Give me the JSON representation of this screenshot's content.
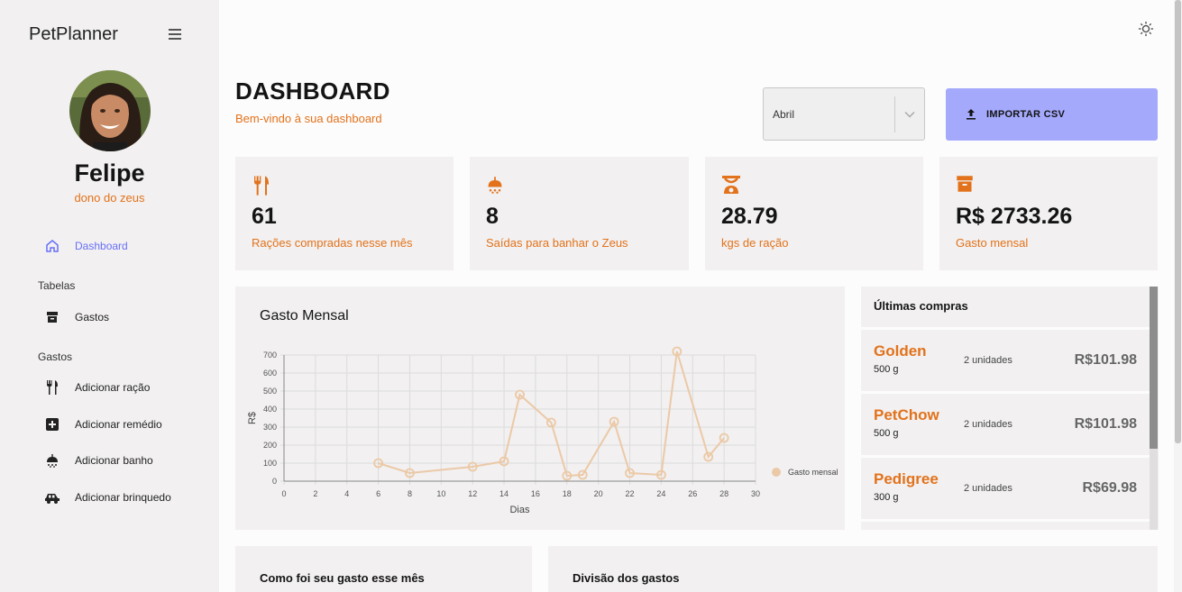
{
  "app": {
    "title": "PetPlanner"
  },
  "user": {
    "name": "Felipe",
    "role": "dono do zeus"
  },
  "nav": {
    "dashboard": "Dashboard",
    "section_tables": "Tabelas",
    "gastos": "Gastos",
    "section_gastos": "Gastos",
    "add_racao": "Adicionar ração",
    "add_remedio": "Adicionar remédio",
    "add_banho": "Adicionar banho",
    "add_brinquedo": "Adicionar brinquedo"
  },
  "header": {
    "title": "DASHBOARD",
    "subtitle": "Bem-vindo à sua dashboard"
  },
  "month_select": {
    "value": "Abril"
  },
  "import_button": {
    "label": "IMPORTAR CSV"
  },
  "stats": [
    {
      "value": "61",
      "label": "Rações compradas nesse mês",
      "icon": "utensils-icon"
    },
    {
      "value": "8",
      "label": "Saídas para banhar o Zeus",
      "icon": "shower-icon"
    },
    {
      "value": "28.79",
      "label": "kgs de ração",
      "icon": "scale-icon"
    },
    {
      "value": "R$ 2733.26",
      "label": "Gasto mensal",
      "icon": "archive-icon"
    }
  ],
  "chart_card": {
    "title": "Gasto Mensal"
  },
  "chart_data": {
    "type": "line",
    "title": "Gasto Mensal",
    "xlabel": "Dias",
    "ylabel": "R$",
    "xlim": [
      0,
      30
    ],
    "ylim": [
      0,
      700
    ],
    "xticks": [
      "0",
      "2",
      "4",
      "6",
      "8",
      "10",
      "12",
      "14",
      "16",
      "18",
      "20",
      "22",
      "24",
      "26",
      "28",
      "30"
    ],
    "yticks": [
      "0",
      "100",
      "200",
      "300",
      "400",
      "500",
      "600",
      "700"
    ],
    "grid": true,
    "legend_position": "right",
    "series": [
      {
        "name": "Gasto mensal",
        "color": "#ebc9a7",
        "points": [
          [
            6,
            100
          ],
          [
            8,
            45
          ],
          [
            12,
            80
          ],
          [
            14,
            110
          ],
          [
            15,
            480
          ],
          [
            17,
            325
          ],
          [
            18,
            30
          ],
          [
            19,
            35
          ],
          [
            21,
            330
          ],
          [
            22,
            45
          ],
          [
            24,
            35
          ],
          [
            25,
            720
          ],
          [
            27,
            135
          ],
          [
            28,
            240
          ]
        ]
      }
    ]
  },
  "purchases": {
    "title": "Últimas compras",
    "items": [
      {
        "name": "Golden",
        "weight": "500 g",
        "qty": "2 unidades",
        "price": "R$101.98"
      },
      {
        "name": "PetChow",
        "weight": "500 g",
        "qty": "2 unidades",
        "price": "R$101.98"
      },
      {
        "name": "Pedigree",
        "weight": "300 g",
        "qty": "2 unidades",
        "price": "R$69.98"
      }
    ]
  },
  "bottom_cards": {
    "left_title": "Como foi seu gasto esse mês",
    "right_title": "Divisão dos gastos"
  },
  "colors": {
    "accent": "#e2721b",
    "primary": "#6870fa",
    "import_bg": "#a4a9fc"
  }
}
